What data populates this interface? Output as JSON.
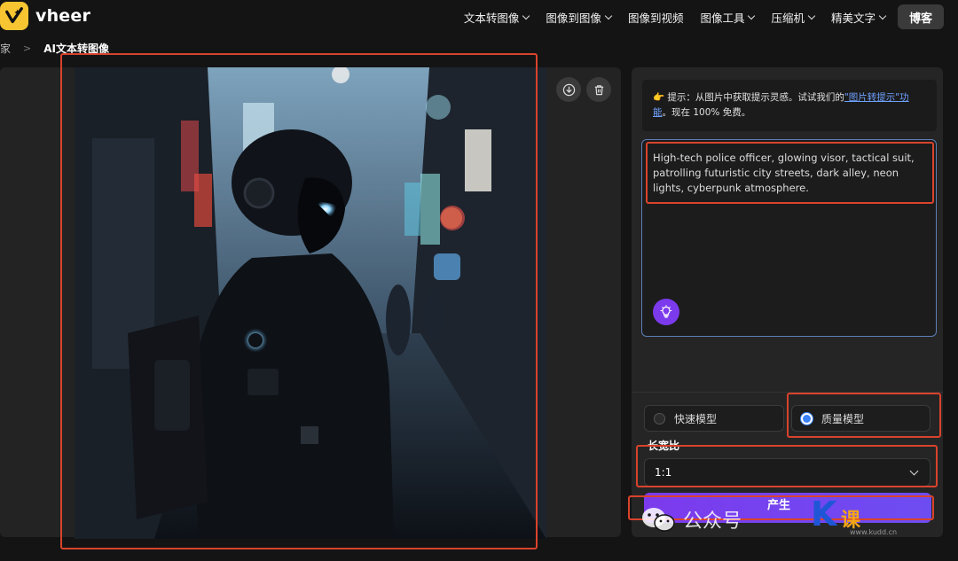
{
  "header": {
    "brand": "vheer",
    "nav": [
      {
        "label": "文本转图像",
        "has_dropdown": true
      },
      {
        "label": "图像到图像",
        "has_dropdown": true
      },
      {
        "label": "图像到视频",
        "has_dropdown": false
      },
      {
        "label": "图像工具",
        "has_dropdown": true
      },
      {
        "label": "压缩机",
        "has_dropdown": true
      },
      {
        "label": "精美文字",
        "has_dropdown": true
      }
    ],
    "blog_button": "博客"
  },
  "breadcrumb": {
    "home": "家",
    "separator": ">",
    "current": "AI文本转图像"
  },
  "result": {
    "download_icon": "download-icon",
    "delete_icon": "trash-icon"
  },
  "controls": {
    "tip_prefix": "👉 提示：从图片中获取提示灵感。试试我们的",
    "tip_link": "\"图片转提示\"功能",
    "tip_suffix": "。现在 100% 免费。",
    "prompt": "High-tech police officer, glowing visor, tactical suit, patrolling futuristic city streets, dark alley, neon lights, cyberpunk atmosphere.",
    "models": [
      {
        "label": "快速模型",
        "selected": false
      },
      {
        "label": "质量模型",
        "selected": true
      }
    ],
    "aspect_label": "长宽比",
    "aspect_value": "1:1",
    "generate_button": "产生"
  },
  "watermark": {
    "channel": "公众号",
    "brand_k": "K",
    "brand_text": "课",
    "url": "www.kudd.cn"
  },
  "colors": {
    "accent": "#7c3aed",
    "logo": "#f6c531",
    "annotation": "#d9432c",
    "link": "#6fa2ff"
  }
}
